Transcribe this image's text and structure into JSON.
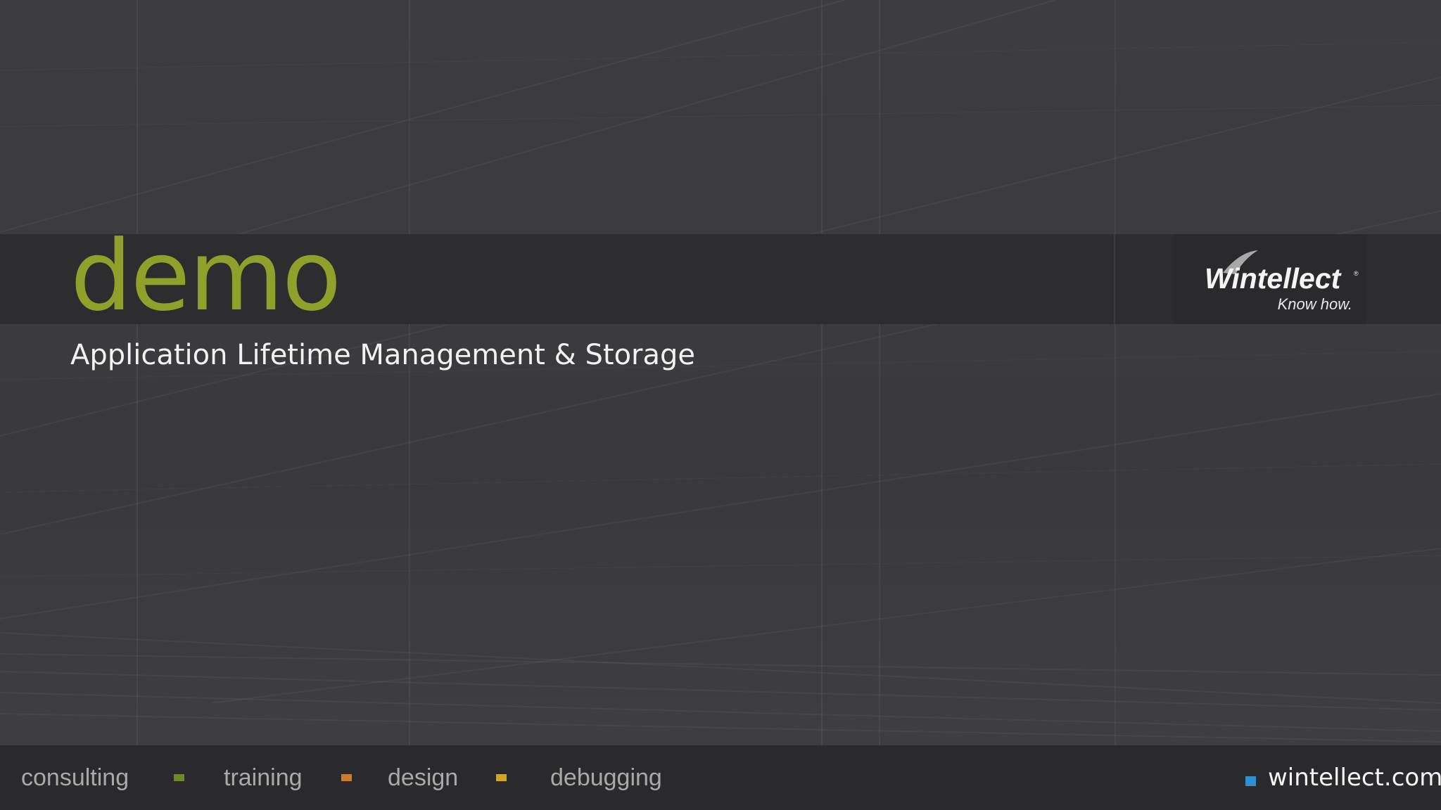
{
  "slide": {
    "title": "demo",
    "subtitle": "Application Lifetime Management & Storage"
  },
  "logo": {
    "name": "Wintellect",
    "tagline": "Know how."
  },
  "footer": {
    "items": [
      {
        "label": "consulting"
      },
      {
        "label": "training"
      },
      {
        "label": "design"
      },
      {
        "label": "debugging"
      }
    ],
    "bullets": [
      {
        "color": "#6d8a2a"
      },
      {
        "color": "#d07a2a"
      },
      {
        "color": "#d6a619"
      }
    ],
    "website": "wintellect.com",
    "website_bullet_color": "#2f8fd0"
  },
  "colors": {
    "title": "#8fa12a",
    "band": "#2d2d2f",
    "background": "#3b3b3d"
  }
}
